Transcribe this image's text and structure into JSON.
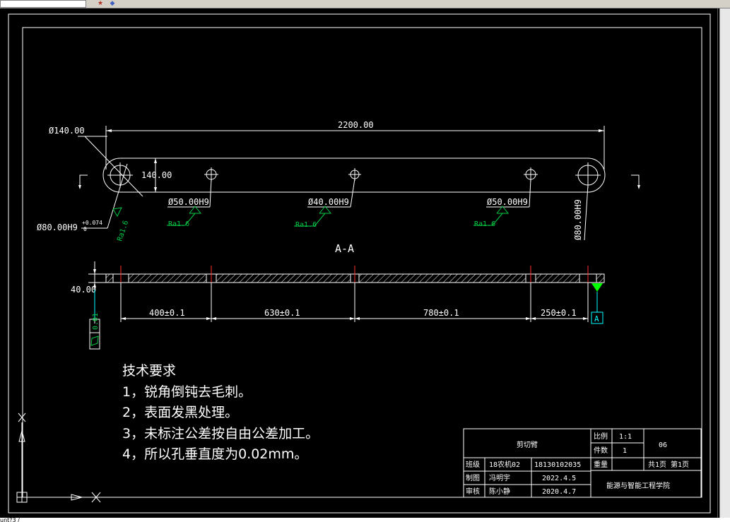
{
  "window": {
    "toolbar_icons": [
      "layer-icon",
      "properties-icon"
    ],
    "command_text": "unt?3 /"
  },
  "part": {
    "overall_length": "2200.00",
    "end_dia": "Ø140.00",
    "width": "140.00",
    "hole_left": "Ø80.00H9",
    "hole_left_tol_upper": "+0.074",
    "hole_left_tol_lower": "0",
    "hole_2": "Ø50.00H9",
    "hole_3": "Ø40.00H9",
    "hole_4": "Ø50.00H9",
    "hole_right": "Ø80.00H9",
    "roughness_1": "Ra1.6",
    "roughness_2": "Ra1.6",
    "roughness_3": "Ra1.6",
    "roughness_4": "Ra1.6",
    "roughness_5": "Ra1.6"
  },
  "section": {
    "title": "A-A",
    "thickness": "40.00",
    "dim_1": "400±0.1",
    "dim_2": "630±0.1",
    "dim_3": "780±0.1",
    "dim_4": "250±0.1",
    "flatness": "0.01",
    "datum": "A"
  },
  "notes": {
    "title": "技术要求",
    "items": [
      "1，锐角倒钝去毛刺。",
      "2，表面发黑处理。",
      "3，未标注公差按自由公差加工。",
      "4，所以孔垂直度为0.02mm。"
    ]
  },
  "title_block": {
    "part_name": "剪切臂",
    "scale_label": "比例",
    "scale_value": "1:1",
    "qty_label": "件数",
    "qty_value": "1",
    "drawing_no": "06",
    "class_label": "班级",
    "class_value": "18农机02",
    "student_id": "18130102035",
    "weight_label": "重量",
    "pages": "共1页 第1页",
    "drawn_label": "制图",
    "drawn_name": "冯明宇",
    "drawn_date": "2022.4.5",
    "checked_label": "审核",
    "checked_name": "陈小静",
    "checked_date": "2020.4.7",
    "school": "能源与智能工程学院"
  },
  "colors": {
    "background": "#000000",
    "lines": "#ffffff",
    "roughness": "#00cc44",
    "centerline": "#ff3030",
    "datum": "#00ffff",
    "datum_fill": "#00ff00"
  }
}
